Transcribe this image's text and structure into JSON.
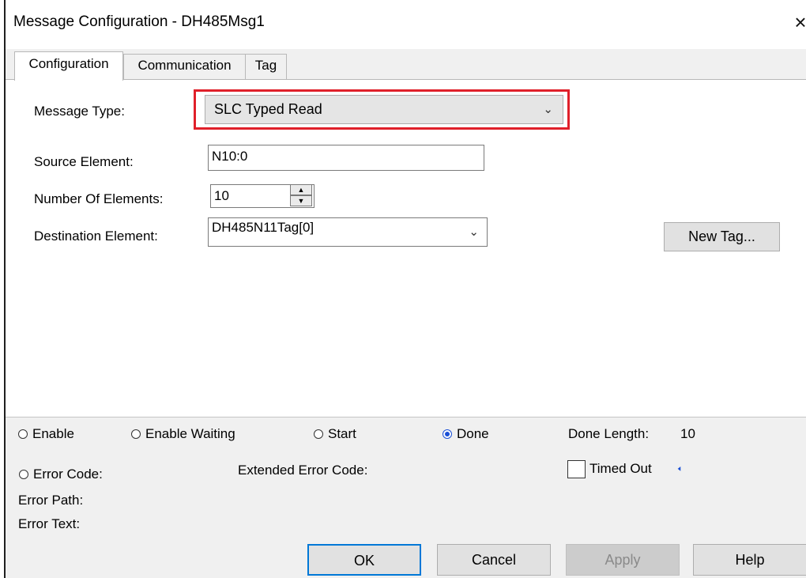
{
  "window": {
    "title": "Message Configuration - DH485Msg1",
    "close_glyph": "×"
  },
  "tabs": [
    {
      "label": "Configuration",
      "active": true
    },
    {
      "label": "Communication",
      "active": false
    },
    {
      "label": "Tag",
      "active": false
    }
  ],
  "config": {
    "message_type_label": "Message Type:",
    "message_type_value": "SLC Typed Read",
    "source_element_label": "Source Element:",
    "source_element_value": "N10:0",
    "number_elements_label": "Number Of Elements:",
    "number_elements_value": "10",
    "destination_element_label": "Destination Element:",
    "destination_element_value": "DH485N11Tag[0]",
    "new_tag_button": "New Tag..."
  },
  "status": {
    "enable": {
      "label": "Enable",
      "checked": false
    },
    "enable_waiting": {
      "label": "Enable Waiting",
      "checked": false
    },
    "start": {
      "label": "Start",
      "checked": false
    },
    "done": {
      "label": "Done",
      "checked": true
    },
    "done_length_label": "Done Length:",
    "done_length_value": "10",
    "error_code_label": "Error Code:",
    "extended_error_code_label": "Extended Error Code:",
    "timed_out_label": "Timed Out",
    "timed_out_checked": false,
    "error_path_label": "Error Path:",
    "error_text_label": "Error Text:"
  },
  "buttons": {
    "ok": "OK",
    "cancel": "Cancel",
    "apply": "Apply",
    "help": "Help"
  },
  "icons": {
    "chevron": "chevron-down-icon",
    "spin_up": "spin-up-icon",
    "spin_down": "spin-down-icon",
    "timed_out_arrow": "arrow-left-icon"
  },
  "colors": {
    "highlight_border": "#e0202a",
    "ok_focus": "#0078d7",
    "radio_selected": "#1a4fd6"
  }
}
